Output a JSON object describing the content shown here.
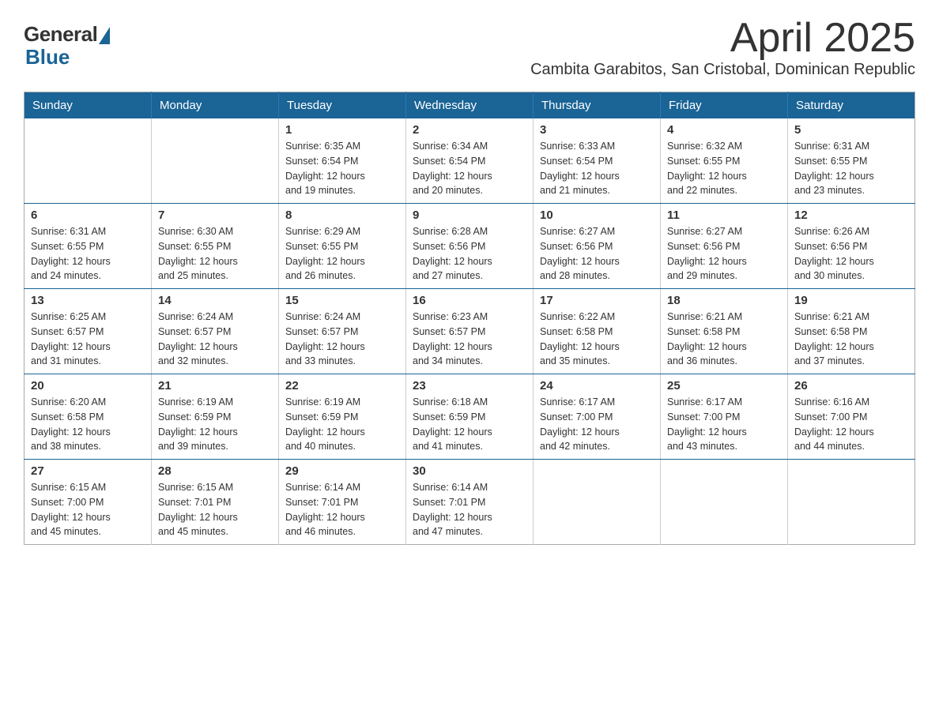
{
  "header": {
    "logo_general": "General",
    "logo_blue": "Blue",
    "month_title": "April 2025",
    "location": "Cambita Garabitos, San Cristobal, Dominican Republic"
  },
  "weekdays": [
    "Sunday",
    "Monday",
    "Tuesday",
    "Wednesday",
    "Thursday",
    "Friday",
    "Saturday"
  ],
  "weeks": [
    [
      {
        "day": "",
        "info": ""
      },
      {
        "day": "",
        "info": ""
      },
      {
        "day": "1",
        "info": "Sunrise: 6:35 AM\nSunset: 6:54 PM\nDaylight: 12 hours\nand 19 minutes."
      },
      {
        "day": "2",
        "info": "Sunrise: 6:34 AM\nSunset: 6:54 PM\nDaylight: 12 hours\nand 20 minutes."
      },
      {
        "day": "3",
        "info": "Sunrise: 6:33 AM\nSunset: 6:54 PM\nDaylight: 12 hours\nand 21 minutes."
      },
      {
        "day": "4",
        "info": "Sunrise: 6:32 AM\nSunset: 6:55 PM\nDaylight: 12 hours\nand 22 minutes."
      },
      {
        "day": "5",
        "info": "Sunrise: 6:31 AM\nSunset: 6:55 PM\nDaylight: 12 hours\nand 23 minutes."
      }
    ],
    [
      {
        "day": "6",
        "info": "Sunrise: 6:31 AM\nSunset: 6:55 PM\nDaylight: 12 hours\nand 24 minutes."
      },
      {
        "day": "7",
        "info": "Sunrise: 6:30 AM\nSunset: 6:55 PM\nDaylight: 12 hours\nand 25 minutes."
      },
      {
        "day": "8",
        "info": "Sunrise: 6:29 AM\nSunset: 6:55 PM\nDaylight: 12 hours\nand 26 minutes."
      },
      {
        "day": "9",
        "info": "Sunrise: 6:28 AM\nSunset: 6:56 PM\nDaylight: 12 hours\nand 27 minutes."
      },
      {
        "day": "10",
        "info": "Sunrise: 6:27 AM\nSunset: 6:56 PM\nDaylight: 12 hours\nand 28 minutes."
      },
      {
        "day": "11",
        "info": "Sunrise: 6:27 AM\nSunset: 6:56 PM\nDaylight: 12 hours\nand 29 minutes."
      },
      {
        "day": "12",
        "info": "Sunrise: 6:26 AM\nSunset: 6:56 PM\nDaylight: 12 hours\nand 30 minutes."
      }
    ],
    [
      {
        "day": "13",
        "info": "Sunrise: 6:25 AM\nSunset: 6:57 PM\nDaylight: 12 hours\nand 31 minutes."
      },
      {
        "day": "14",
        "info": "Sunrise: 6:24 AM\nSunset: 6:57 PM\nDaylight: 12 hours\nand 32 minutes."
      },
      {
        "day": "15",
        "info": "Sunrise: 6:24 AM\nSunset: 6:57 PM\nDaylight: 12 hours\nand 33 minutes."
      },
      {
        "day": "16",
        "info": "Sunrise: 6:23 AM\nSunset: 6:57 PM\nDaylight: 12 hours\nand 34 minutes."
      },
      {
        "day": "17",
        "info": "Sunrise: 6:22 AM\nSunset: 6:58 PM\nDaylight: 12 hours\nand 35 minutes."
      },
      {
        "day": "18",
        "info": "Sunrise: 6:21 AM\nSunset: 6:58 PM\nDaylight: 12 hours\nand 36 minutes."
      },
      {
        "day": "19",
        "info": "Sunrise: 6:21 AM\nSunset: 6:58 PM\nDaylight: 12 hours\nand 37 minutes."
      }
    ],
    [
      {
        "day": "20",
        "info": "Sunrise: 6:20 AM\nSunset: 6:58 PM\nDaylight: 12 hours\nand 38 minutes."
      },
      {
        "day": "21",
        "info": "Sunrise: 6:19 AM\nSunset: 6:59 PM\nDaylight: 12 hours\nand 39 minutes."
      },
      {
        "day": "22",
        "info": "Sunrise: 6:19 AM\nSunset: 6:59 PM\nDaylight: 12 hours\nand 40 minutes."
      },
      {
        "day": "23",
        "info": "Sunrise: 6:18 AM\nSunset: 6:59 PM\nDaylight: 12 hours\nand 41 minutes."
      },
      {
        "day": "24",
        "info": "Sunrise: 6:17 AM\nSunset: 7:00 PM\nDaylight: 12 hours\nand 42 minutes."
      },
      {
        "day": "25",
        "info": "Sunrise: 6:17 AM\nSunset: 7:00 PM\nDaylight: 12 hours\nand 43 minutes."
      },
      {
        "day": "26",
        "info": "Sunrise: 6:16 AM\nSunset: 7:00 PM\nDaylight: 12 hours\nand 44 minutes."
      }
    ],
    [
      {
        "day": "27",
        "info": "Sunrise: 6:15 AM\nSunset: 7:00 PM\nDaylight: 12 hours\nand 45 minutes."
      },
      {
        "day": "28",
        "info": "Sunrise: 6:15 AM\nSunset: 7:01 PM\nDaylight: 12 hours\nand 45 minutes."
      },
      {
        "day": "29",
        "info": "Sunrise: 6:14 AM\nSunset: 7:01 PM\nDaylight: 12 hours\nand 46 minutes."
      },
      {
        "day": "30",
        "info": "Sunrise: 6:14 AM\nSunset: 7:01 PM\nDaylight: 12 hours\nand 47 minutes."
      },
      {
        "day": "",
        "info": ""
      },
      {
        "day": "",
        "info": ""
      },
      {
        "day": "",
        "info": ""
      }
    ]
  ]
}
